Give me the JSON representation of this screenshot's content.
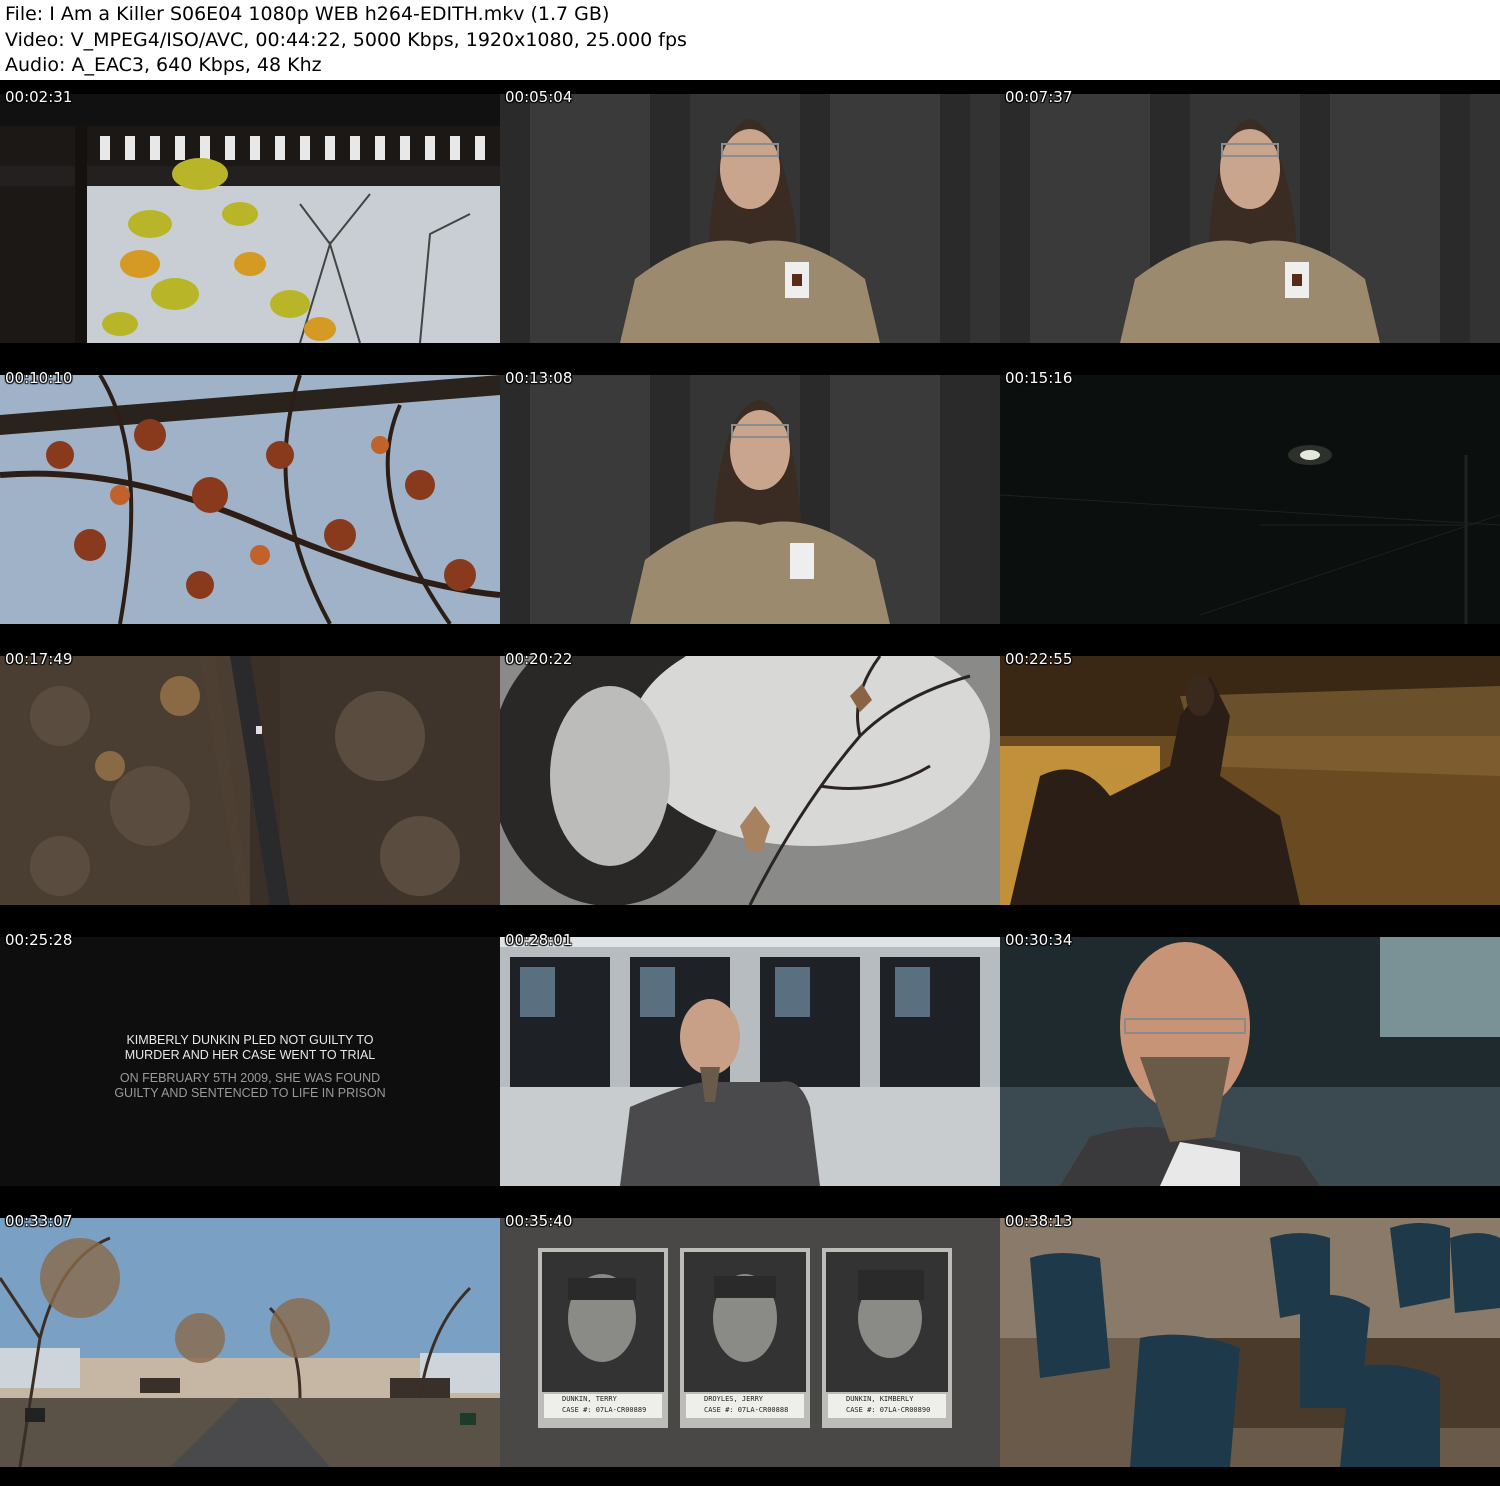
{
  "header": {
    "file_line": "File: I Am a Killer S06E04 1080p WEB h264-EDITH.mkv (1.7 GB)",
    "video_line": "Video: V_MPEG4/ISO/AVC, 00:44:22, 5000 Kbps, 1920x1080, 25.000 fps",
    "audio_line": "Audio: A_EAC3, 640 Kbps, 48 Khz"
  },
  "thumbnails": [
    {
      "timestamp": "00:02:31"
    },
    {
      "timestamp": "00:05:04"
    },
    {
      "timestamp": "00:07:37"
    },
    {
      "timestamp": "00:10:10"
    },
    {
      "timestamp": "00:13:08"
    },
    {
      "timestamp": "00:15:16"
    },
    {
      "timestamp": "00:17:49"
    },
    {
      "timestamp": "00:20:22"
    },
    {
      "timestamp": "00:22:55"
    },
    {
      "timestamp": "00:25:28"
    },
    {
      "timestamp": "00:28:01"
    },
    {
      "timestamp": "00:30:34"
    },
    {
      "timestamp": "00:33:07"
    },
    {
      "timestamp": "00:35:40"
    },
    {
      "timestamp": "00:38:13"
    }
  ],
  "title_card": {
    "line1": "KIMBERLY DUNKIN PLED NOT GUILTY TO",
    "line2": "MURDER AND HER CASE WENT TO TRIAL",
    "line3": "ON FEBRUARY 5TH 2009, SHE WAS FOUND",
    "line4": "GUILTY AND SENTENCED TO LIFE IN PRISON"
  },
  "mugshots": [
    {
      "name": "DUNKIN, TERRY",
      "case": "CASE #: 07LA-CR00889"
    },
    {
      "name": "DROYLES, JERRY",
      "case": "CASE #: 07LA-CR00888"
    },
    {
      "name": "DUNKIN, KIMBERLY",
      "case": "CASE #: 07LA-CR00890"
    }
  ]
}
